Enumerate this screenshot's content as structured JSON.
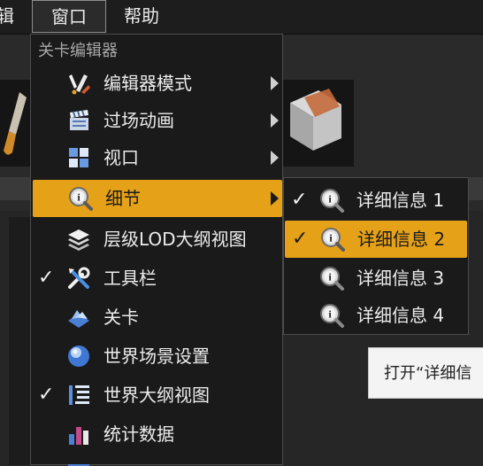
{
  "menubar": {
    "items": [
      {
        "label": "辑"
      },
      {
        "label": "窗口"
      },
      {
        "label": "帮助"
      }
    ]
  },
  "dropdown": {
    "header": "关卡编辑器",
    "items": [
      {
        "label": "编辑器模式",
        "icon": "editor-modes-icon",
        "checked": false,
        "submenu": true
      },
      {
        "label": "过场动画",
        "icon": "clapperboard-icon",
        "checked": false,
        "submenu": true
      },
      {
        "label": "视口",
        "icon": "viewport-grid-icon",
        "checked": false,
        "submenu": true
      },
      {
        "label": "细节",
        "icon": "details-magnifier-icon",
        "checked": false,
        "submenu": true,
        "highlighted": true
      },
      {
        "label": "层级LOD大纲视图",
        "icon": "layers-icon",
        "checked": false,
        "submenu": false
      },
      {
        "label": "工具栏",
        "icon": "tools-wrench-icon",
        "checked": true,
        "checkmark": "✓",
        "submenu": false
      },
      {
        "label": "关卡",
        "icon": "levels-icon",
        "checked": false,
        "submenu": false
      },
      {
        "label": "世界场景设置",
        "icon": "world-sphere-icon",
        "checked": false,
        "submenu": false
      },
      {
        "label": "世界大纲视图",
        "icon": "outliner-list-icon",
        "checked": true,
        "checkmark": "✓",
        "submenu": false
      },
      {
        "label": "统计数据",
        "icon": "statistics-chart-icon",
        "checked": false,
        "submenu": false
      }
    ]
  },
  "submenu": {
    "items": [
      {
        "label": "详细信息 1",
        "checked": true,
        "checkmark": "✓"
      },
      {
        "label": "详细信息 2",
        "checked": true,
        "checkmark": "✓",
        "highlighted": true
      },
      {
        "label": "详细信息 3",
        "checked": false
      },
      {
        "label": "详细信息 4",
        "checked": false
      }
    ]
  },
  "tooltip": {
    "text": "打开“详细信"
  },
  "colors": {
    "accent": "#e5a117",
    "menu_bg": "#1a1a1a",
    "menubar_bg": "#1d1d1d"
  }
}
